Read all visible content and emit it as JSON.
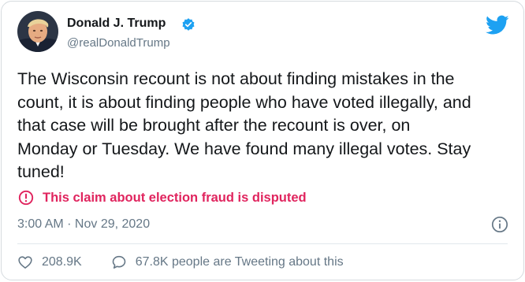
{
  "author": {
    "display_name": "Donald J. Trump",
    "handle": "@realDonaldTrump",
    "verified": true,
    "avatar_icon": "profile-photo",
    "verified_icon": "verified-badge-icon"
  },
  "brand": {
    "logo_icon": "twitter-bird-icon",
    "accent_color": "#1da1f2"
  },
  "tweet": {
    "text_lines": [
      "The Wisconsin recount is not about finding mistakes in the",
      "count, it is about finding people who have voted illegally, and",
      "that case will be brought after the recount is over, on",
      "Monday or Tuesday. We have found many illegal votes. Stay",
      "tuned!"
    ],
    "timestamp": "3:00 AM · Nov 29, 2020"
  },
  "notice": {
    "label": "This claim about election fraud is disputed",
    "icon": "exclamation-circle-icon",
    "color": "#e0245e"
  },
  "actions": {
    "likes_count": "208.9K",
    "like_icon": "heart-icon",
    "reply_label": "67.8K people are Tweeting about this",
    "reply_icon": "speech-bubble-icon",
    "info_icon": "info-icon"
  },
  "colors": {
    "text_primary": "#14171a",
    "text_secondary": "#657786",
    "border": "#d6dbdf"
  }
}
